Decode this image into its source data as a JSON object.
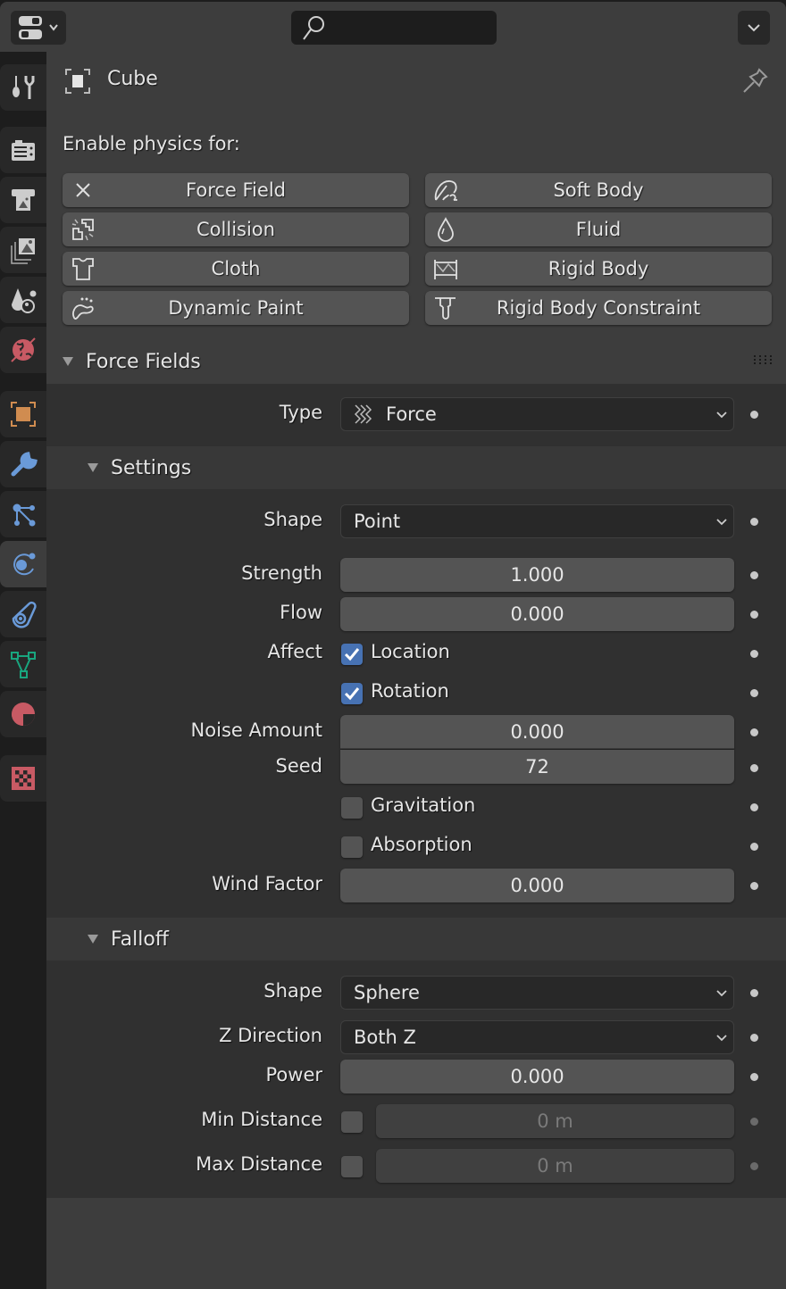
{
  "header": {
    "editor_type_icon": "properties-editor-icon",
    "search": {
      "placeholder": "",
      "value": "",
      "icon": "search-icon"
    },
    "options_icon": "chevron-down-icon"
  },
  "tabs": [
    {
      "name": "tool",
      "icon": "tool-icon",
      "active": false
    },
    {
      "name": "render",
      "icon": "render-icon",
      "active": false
    },
    {
      "name": "output",
      "icon": "output-icon",
      "active": false
    },
    {
      "name": "view-layer",
      "icon": "view-layer-icon",
      "active": false
    },
    {
      "name": "scene",
      "icon": "scene-icon",
      "active": false
    },
    {
      "name": "world",
      "icon": "world-icon",
      "active": false
    },
    {
      "name": "object",
      "icon": "object-icon",
      "active": false
    },
    {
      "name": "modifiers",
      "icon": "wrench-icon",
      "active": false
    },
    {
      "name": "particles",
      "icon": "particles-icon",
      "active": false
    },
    {
      "name": "physics",
      "icon": "physics-icon",
      "active": true
    },
    {
      "name": "constraints",
      "icon": "constraints-icon",
      "active": false
    },
    {
      "name": "data",
      "icon": "mesh-data-icon",
      "active": false
    },
    {
      "name": "material",
      "icon": "material-icon",
      "active": false
    },
    {
      "name": "texture",
      "icon": "texture-icon",
      "active": false
    }
  ],
  "context": {
    "object_name": "Cube",
    "pin_icon": "pin-icon"
  },
  "physics": {
    "enable_label": "Enable physics for:",
    "buttons": [
      {
        "label": "Force Field",
        "icon": "close-x-icon"
      },
      {
        "label": "Soft Body",
        "icon": "soft-body-icon"
      },
      {
        "label": "Collision",
        "icon": "collision-icon"
      },
      {
        "label": "Fluid",
        "icon": "fluid-drop-icon"
      },
      {
        "label": "Cloth",
        "icon": "cloth-shirt-icon"
      },
      {
        "label": "Rigid Body",
        "icon": "rigid-body-icon"
      },
      {
        "label": "Dynamic Paint",
        "icon": "dynamic-paint-icon"
      },
      {
        "label": "Rigid Body Constraint",
        "icon": "rigid-body-constraint-icon"
      }
    ]
  },
  "force_fields": {
    "title": "Force Fields",
    "type_label": "Type",
    "type_value": "Force",
    "settings": {
      "title": "Settings",
      "shape_label": "Shape",
      "shape_value": "Point",
      "strength_label": "Strength",
      "strength_value": "1.000",
      "flow_label": "Flow",
      "flow_value": "0.000",
      "affect_label": "Affect",
      "location_label": "Location",
      "location_checked": true,
      "rotation_label": "Rotation",
      "rotation_checked": true,
      "noise_label": "Noise Amount",
      "noise_value": "0.000",
      "seed_label": "Seed",
      "seed_value": "72",
      "gravitation_label": "Gravitation",
      "gravitation_checked": false,
      "absorption_label": "Absorption",
      "absorption_checked": false,
      "wind_label": "Wind Factor",
      "wind_value": "0.000"
    },
    "falloff": {
      "title": "Falloff",
      "shape_label": "Shape",
      "shape_value": "Sphere",
      "zdir_label": "Z Direction",
      "zdir_value": "Both Z",
      "power_label": "Power",
      "power_value": "0.000",
      "min_label": "Min Distance",
      "min_checked": false,
      "min_value": "0 m",
      "max_label": "Max Distance",
      "max_checked": false,
      "max_value": "0 m"
    }
  },
  "colors": {
    "accent_blue": "#4772b3",
    "object_orange": "#d08c50",
    "physics_blue": "#6a9ad8",
    "mesh_green": "#19a67f",
    "world_red": "#c85a64"
  }
}
